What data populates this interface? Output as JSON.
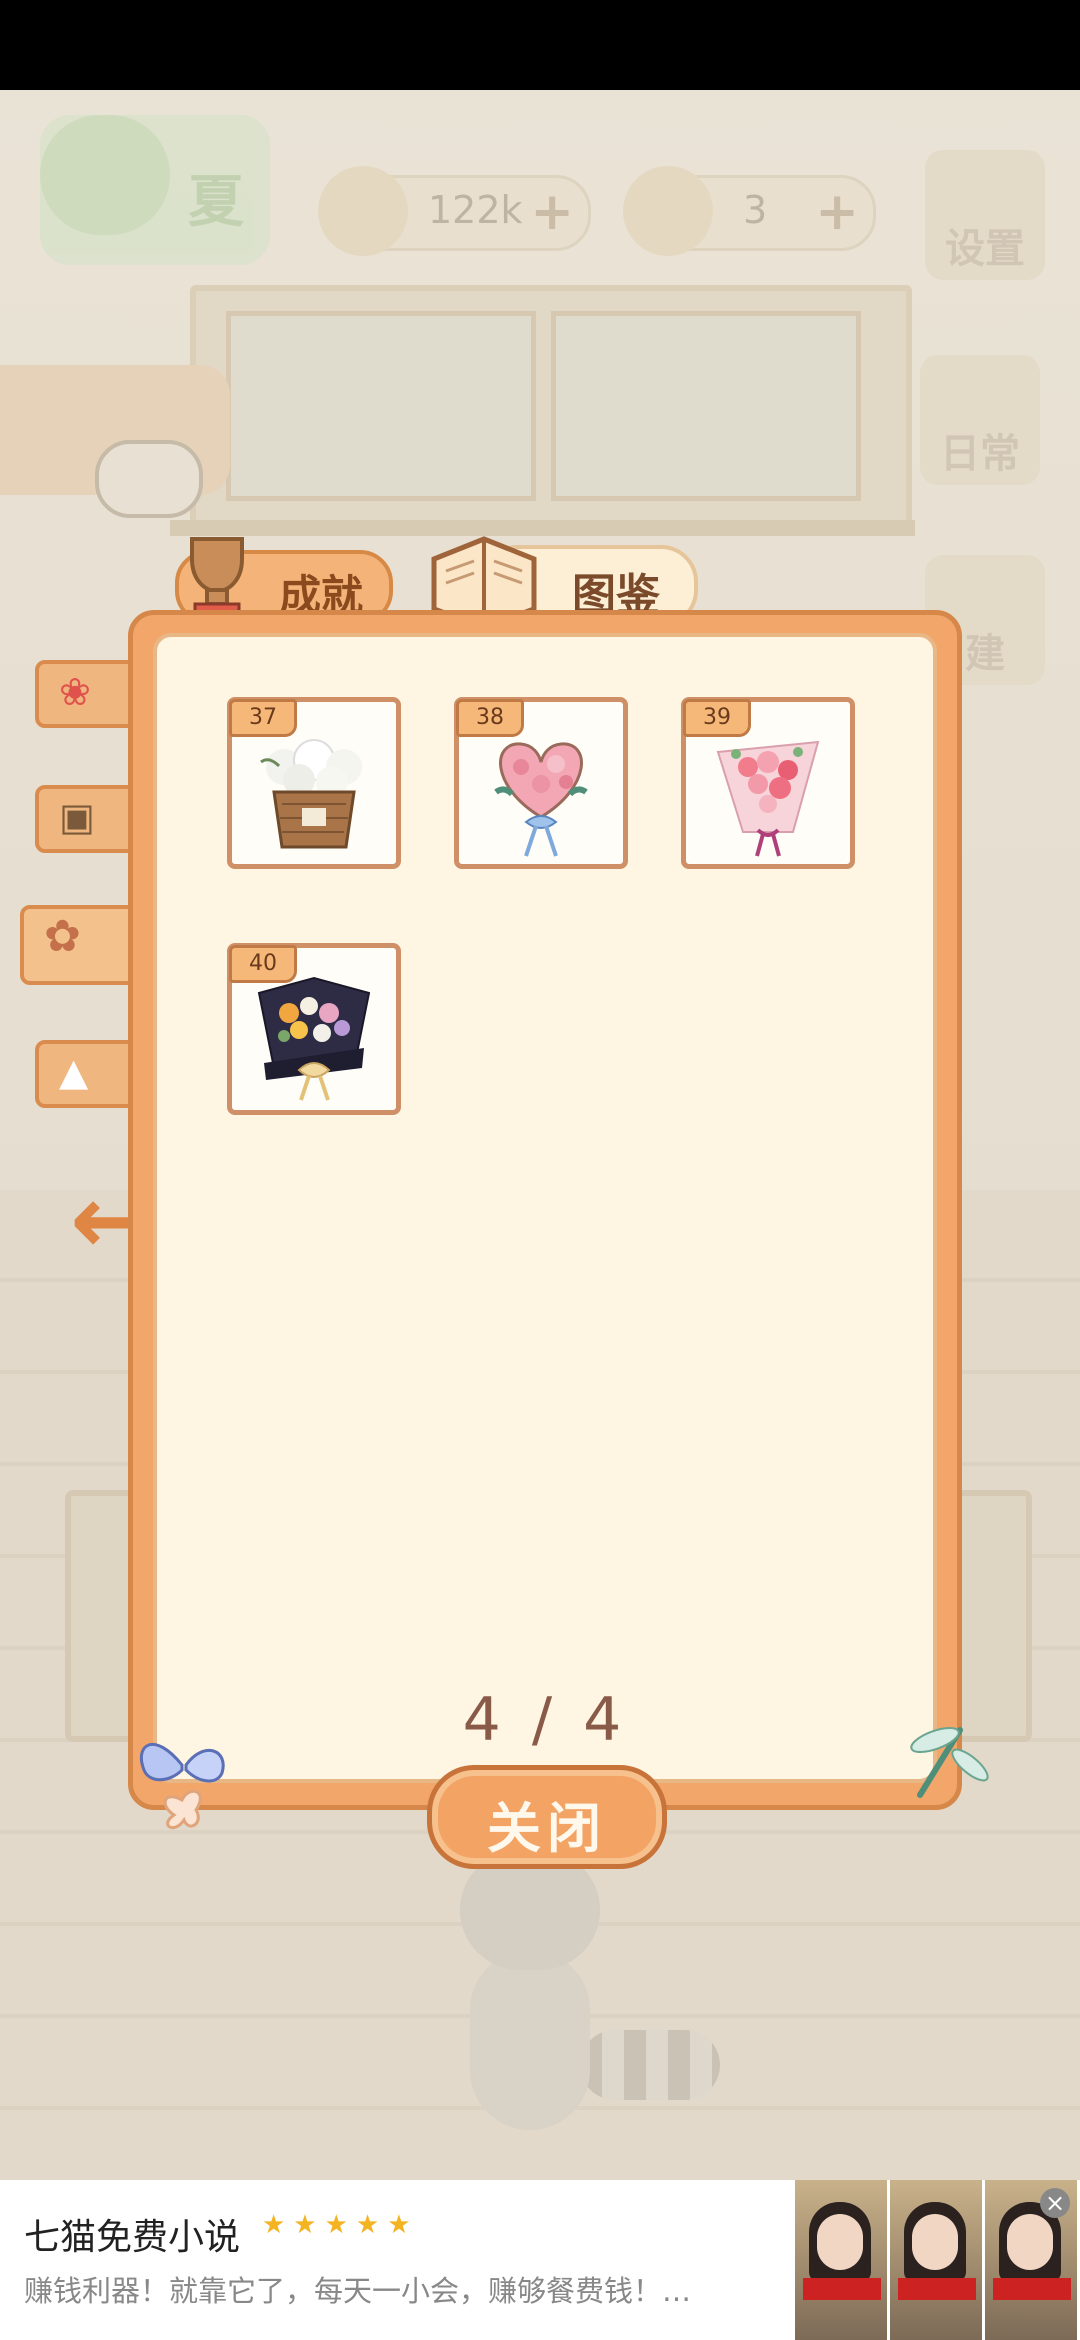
{
  "header": {
    "logo_text": "夏",
    "resources": [
      {
        "name": "fishbone",
        "icon": "fishbone-icon",
        "value": "122k"
      },
      {
        "name": "cheese",
        "icon": "cheese-icon",
        "value": "3"
      }
    ],
    "side_buttons": [
      {
        "name": "settings",
        "icon": "gear-icon",
        "label": "设置"
      },
      {
        "name": "daily",
        "icon": "notepad-icon",
        "label": "日常"
      },
      {
        "name": "build",
        "icon": "hammer-icon",
        "label": "建"
      }
    ]
  },
  "tabs": {
    "achievement": "成就",
    "catalog": "图鉴"
  },
  "left_tabs": [
    {
      "icon": "rose-icon"
    },
    {
      "icon": "painting-icon"
    },
    {
      "icon": "bouquet-icon",
      "active": true
    },
    {
      "icon": "cat-icon"
    }
  ],
  "catalog": {
    "items": [
      {
        "number": "37",
        "icon": "white-flower-basket-icon"
      },
      {
        "number": "38",
        "icon": "heart-wreath-icon"
      },
      {
        "number": "39",
        "icon": "pink-bouquet-icon"
      },
      {
        "number": "40",
        "icon": "dark-wrapped-bouquet-icon"
      }
    ],
    "page_indicator": "4 / 4"
  },
  "close_button": "关闭",
  "ad": {
    "title": "七猫免费小说",
    "stars": "★★★★★",
    "description": "赚钱利器！就靠它了，每天一小会，赚够餐费钱！…",
    "close_icon": "close-icon"
  },
  "colors": {
    "panel_orange": "#f2a66a",
    "panel_border": "#d6874a",
    "panel_inner": "#fef5e2",
    "accent_brown": "#8a5a48"
  }
}
